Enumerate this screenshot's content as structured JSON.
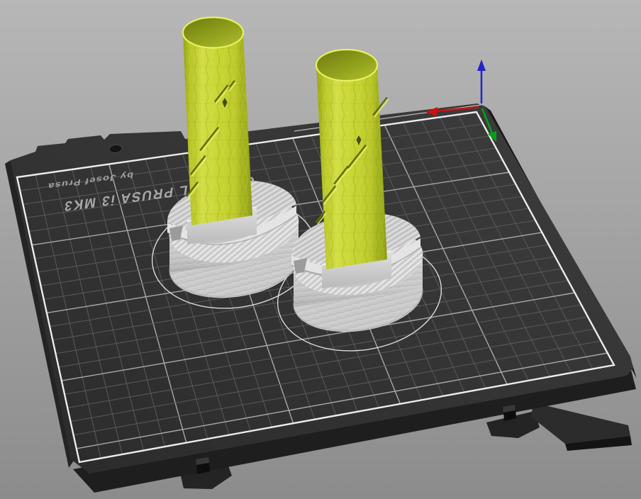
{
  "viewport": {
    "description": "3D slicer build-plate preview with two printed objects",
    "zoom_hint": "perspective view rotated 180 degrees (bed text appears upside down)"
  },
  "bed": {
    "brand_line": "ORIGINAL PRUSA i3 MK3",
    "byline": "by Josef Prusa",
    "size_x_mm": 250,
    "size_y_mm": 210,
    "grid_minor_mm": 10,
    "grid_major_mm": 50,
    "colors": {
      "surface_light": "#3d3d3d",
      "surface_dark": "#2b2b2b",
      "plate_side": "#1e1e1e",
      "grid_minor": "#5a5a5a",
      "grid_major": "#a9a9a9",
      "border": "#ececec",
      "text": "#a8a8a8"
    }
  },
  "axes": {
    "x": "#cc1111",
    "y": "#00a317",
    "z": "#2222cc"
  },
  "objects": [
    {
      "id": "object-1",
      "position": "rear-left",
      "filament_color": "#c3d232",
      "base_color": "#d0d0d0",
      "skirt_color": "#eaeaea"
    },
    {
      "id": "object-2",
      "position": "front-right",
      "filament_color": "#c3d232",
      "base_color": "#d0d0d0",
      "skirt_color": "#eaeaea"
    }
  ],
  "background": {
    "top": "#b7b7b7",
    "bottom": "#8c8c8c"
  }
}
